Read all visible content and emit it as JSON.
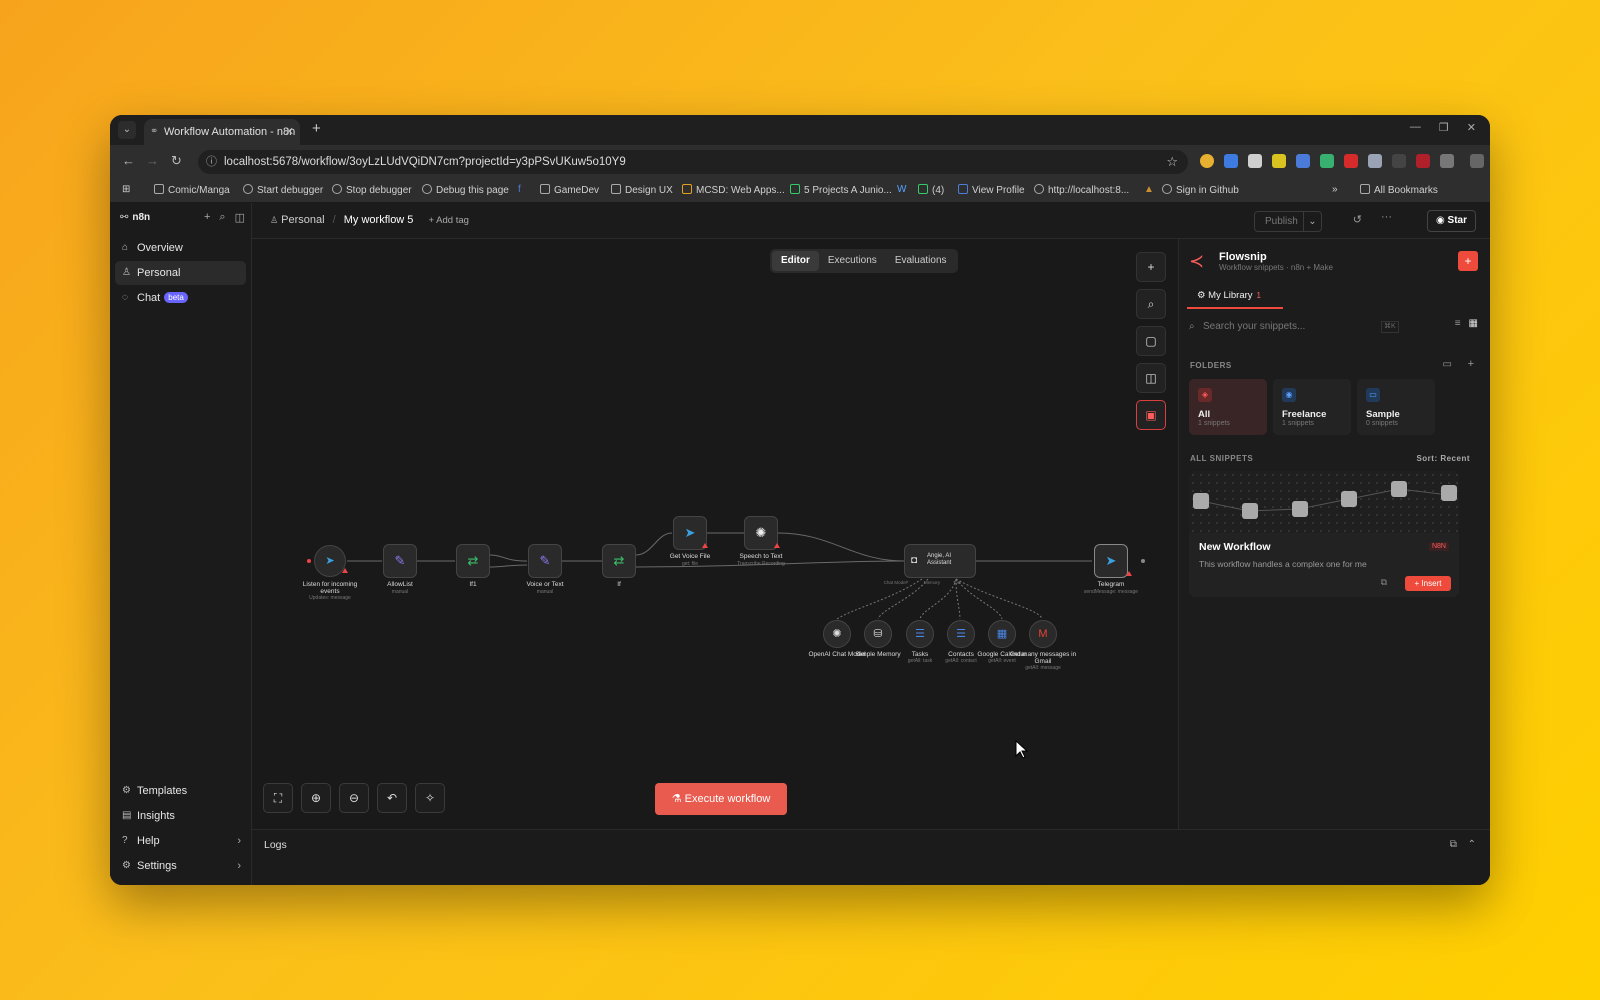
{
  "browser": {
    "tab_title": "Workflow Automation - n8n",
    "url": "localhost:5678/workflow/3oyLzLUdVQiDN7cm?projectId=y3pPSvUKuw5o10Y9",
    "bookmarks": [
      "Comic/Manga",
      "Start debugger",
      "Stop debugger",
      "Debug this page",
      "GameDev",
      "Design UX",
      "MCSD: Web Apps...",
      "5 Projects A Junio...",
      "(4)",
      "View Profile",
      "http://localhost:8...",
      "Sign in Github"
    ],
    "all_bookmarks": "All Bookmarks"
  },
  "sidebar": {
    "brand": "n8n",
    "items": [
      {
        "label": "Overview",
        "icon": "home-icon"
      },
      {
        "label": "Personal",
        "icon": "user-icon"
      },
      {
        "label": "Chat",
        "icon": "chat-icon",
        "badge": "beta"
      }
    ],
    "bottom_items": [
      {
        "label": "Templates",
        "icon": "templates-icon"
      },
      {
        "label": "Insights",
        "icon": "chart-icon"
      },
      {
        "label": "Help",
        "icon": "help-icon"
      },
      {
        "label": "Settings",
        "icon": "gear-icon"
      }
    ]
  },
  "header": {
    "project": "Personal",
    "workflow_name": "My workflow 5",
    "add_tag": "+ Add tag",
    "publish": "Publish",
    "star": "Star"
  },
  "canvas": {
    "tabs": [
      "Editor",
      "Executions",
      "Evaluations"
    ],
    "active_tab": "Editor",
    "execute_label": "Execute workflow",
    "nodes": [
      {
        "label": "Listen for incoming events",
        "sub": "Updates: message"
      },
      {
        "label": "AllowList",
        "sub": "manual"
      },
      {
        "label": "If1",
        "sub": ""
      },
      {
        "label": "Voice or Text",
        "sub": "manual"
      },
      {
        "label": "If",
        "sub": ""
      },
      {
        "label": "Get Voice File",
        "sub": "get: file"
      },
      {
        "label": "Speech to Text",
        "sub": "Transcribe Recording"
      },
      {
        "label": "Angie, AI Assistant",
        "sub": ""
      },
      {
        "label": "Telegram",
        "sub": "sendMessage: message"
      },
      {
        "label": "OpenAI Chat Model",
        "sub": ""
      },
      {
        "label": "Simple Memory",
        "sub": ""
      },
      {
        "label": "Tasks",
        "sub": "getAll: task"
      },
      {
        "label": "Contacts",
        "sub": "getAll: contact"
      },
      {
        "label": "Google Calendar",
        "sub": "getAll: event"
      },
      {
        "label": "Get many messages in Gmail",
        "sub": "getAll: message"
      }
    ],
    "sub_port_labels": [
      "Chat Model*",
      "Memory",
      "Tool"
    ]
  },
  "logs": {
    "label": "Logs"
  },
  "flowsnip": {
    "title": "Flowsnip",
    "subtitle": "Workflow snippets · n8n + Make",
    "tab": "My Library",
    "tab_count": "1",
    "search_placeholder": "Search your snippets...",
    "search_shortcut": "⌘K",
    "folders_heading": "FOLDERS",
    "folders": [
      {
        "name": "All",
        "count": "1 snippets"
      },
      {
        "name": "Freelance",
        "count": "1 snippets"
      },
      {
        "name": "Sample",
        "count": "0 snippets"
      }
    ],
    "snippets_heading": "ALL SNIPPETS",
    "sort": "Sort: Recent",
    "snippet": {
      "title": "New Workflow",
      "tag": "N8N",
      "description": "This workflow handles a complex one for me",
      "insert": "+ Insert"
    }
  },
  "colors": {
    "accent": "#ea5b4f",
    "background_from": "#f7a41c",
    "background_to": "#ffd000"
  }
}
